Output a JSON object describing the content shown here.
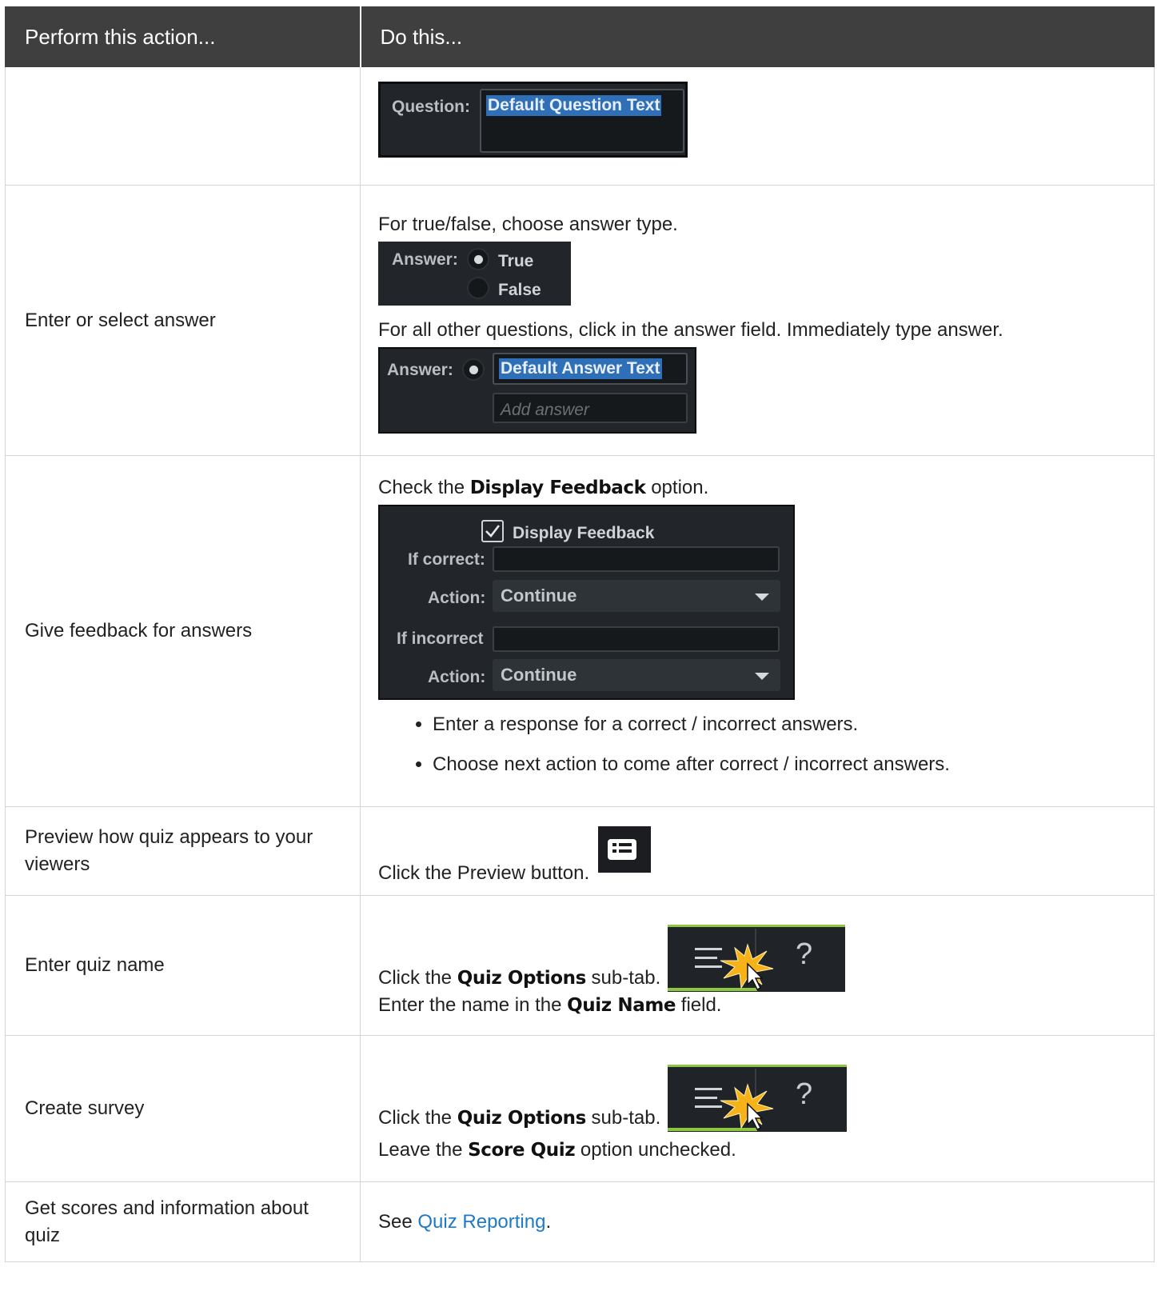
{
  "header": {
    "col1": "Perform this action...",
    "col2": "Do this..."
  },
  "rows": {
    "question": {
      "label": "",
      "widget": {
        "label": "Question:",
        "value": "Default Question Text"
      }
    },
    "answer": {
      "label": "Enter or select answer",
      "text1": "For true/false, choose answer type.",
      "tf_widget": {
        "label": "Answer:",
        "opt_true": "True",
        "opt_false": "False"
      },
      "text2": "For all other questions, click in the answer field. Immediately type answer.",
      "ans_widget": {
        "label": "Answer:",
        "value": "Default Answer Text",
        "placeholder": "Add answer"
      }
    },
    "feedback": {
      "label": "Give feedback for answers",
      "text_pre": "Check the ",
      "text_bold": "Display Feedback",
      "text_post": " option.",
      "widget": {
        "checkbox_label": "Display Feedback",
        "if_correct": "If correct:",
        "action1_label": "Action:",
        "action1_value": "Continue",
        "if_incorrect": "If incorrect",
        "action2_label": "Action:",
        "action2_value": "Continue"
      },
      "bullets": [
        "Enter a response for a correct / incorrect answers.",
        "Choose next action to come after correct / incorrect answers."
      ]
    },
    "preview": {
      "label": "Preview how quiz appears to your viewers",
      "text": "Click the Preview button.",
      "icon": "preview-icon"
    },
    "quiz_name": {
      "label": "Enter quiz name",
      "line1_pre": "Click the ",
      "line1_bold": "Quiz Options",
      "line1_post": " sub-tab.",
      "line2_pre": "Enter the name in the ",
      "line2_bold": "Quiz Name",
      "line2_post": " field.",
      "tab_question_mark": "?"
    },
    "survey": {
      "label": "Create survey",
      "line1_pre": "Click the ",
      "line1_bold": "Quiz Options",
      "line1_post": " sub-tab.",
      "line2_pre": "Leave the ",
      "line2_bold": "Score Quiz",
      "line2_post": " option unchecked.",
      "tab_question_mark": "?"
    },
    "scores": {
      "label": "Get scores and information about quiz",
      "text_pre": "See ",
      "link": "Quiz Reporting",
      "text_post": "."
    }
  },
  "colors": {
    "header_bg": "#3f3f3f",
    "panel_bg": "#22262b",
    "link": "#1e7ac6",
    "tab_accent": "#8dc63f",
    "burst": "#f7b21a"
  }
}
